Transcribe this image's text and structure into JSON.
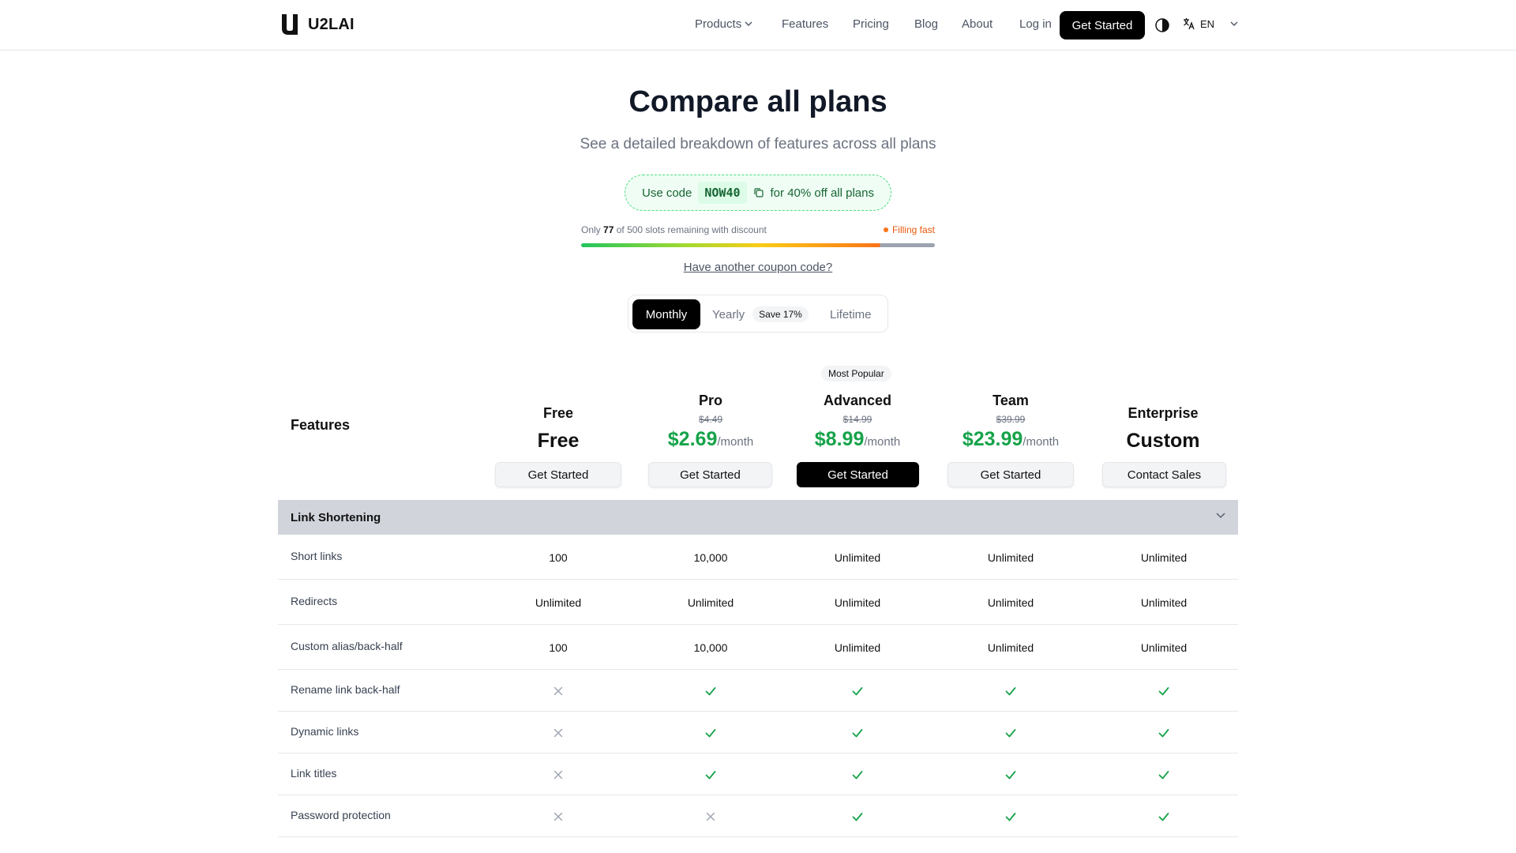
{
  "header": {
    "brand": "U2LAI",
    "nav": [
      {
        "label": "Products",
        "dropdown": true
      },
      {
        "label": "Features"
      },
      {
        "label": "Pricing"
      },
      {
        "label": "Blog"
      },
      {
        "label": "About"
      },
      {
        "label": "Log in"
      }
    ],
    "cta": "Get Started",
    "language": "EN"
  },
  "hero": {
    "title": "Compare all plans",
    "subtitle": "See a detailed breakdown of features across all plans",
    "coupon": {
      "prefix": "Use code",
      "code": "NOW40",
      "suffix": "for 40% off all plans"
    },
    "slots": {
      "prefix": "Only",
      "remaining": "77",
      "suffix": "of 500 slots remaining with discount",
      "status": "Filling fast",
      "fill_fraction": 0.846
    },
    "another_coupon": "Have another coupon code?"
  },
  "billing": {
    "options": [
      "Monthly",
      "Yearly",
      "Lifetime"
    ],
    "selected": "Monthly",
    "yearly_badge": "Save 17%"
  },
  "table": {
    "features_heading": "Features",
    "popular_badge": "Most Popular",
    "plans": [
      {
        "name": "Free",
        "old_price": "",
        "price": "Free",
        "per": "",
        "button": "Get Started"
      },
      {
        "name": "Pro",
        "old_price": "$4.49",
        "price": "$2.69",
        "per": "/month",
        "button": "Get Started"
      },
      {
        "name": "Advanced",
        "old_price": "$14.99",
        "price": "$8.99",
        "per": "/month",
        "button": "Get Started"
      },
      {
        "name": "Team",
        "old_price": "$39.99",
        "price": "$23.99",
        "per": "/month",
        "button": "Get Started"
      },
      {
        "name": "Enterprise",
        "old_price": "",
        "price": "Custom",
        "per": "",
        "button": "Contact Sales"
      }
    ],
    "section": "Link Shortening",
    "rows": [
      {
        "feature": "Short links",
        "values": [
          "100",
          "10,000",
          "Unlimited",
          "Unlimited",
          "Unlimited"
        ]
      },
      {
        "feature": "Redirects",
        "values": [
          "Unlimited",
          "Unlimited",
          "Unlimited",
          "Unlimited",
          "Unlimited"
        ]
      },
      {
        "feature": "Custom alias/back-half",
        "values": [
          "100",
          "10,000",
          "Unlimited",
          "Unlimited",
          "Unlimited"
        ]
      },
      {
        "feature": "Rename link back-half",
        "values": [
          "x",
          "check",
          "check",
          "check",
          "check"
        ]
      },
      {
        "feature": "Dynamic links",
        "values": [
          "x",
          "check",
          "check",
          "check",
          "check"
        ]
      },
      {
        "feature": "Link titles",
        "values": [
          "x",
          "check",
          "check",
          "check",
          "check"
        ]
      },
      {
        "feature": "Password protection",
        "values": [
          "x",
          "x",
          "check",
          "check",
          "check"
        ]
      }
    ]
  },
  "colors": {
    "accent_green": "#16a34a",
    "check": "#16a34a",
    "cross": "#9ca3af",
    "section_bg": "#d1d5db"
  }
}
